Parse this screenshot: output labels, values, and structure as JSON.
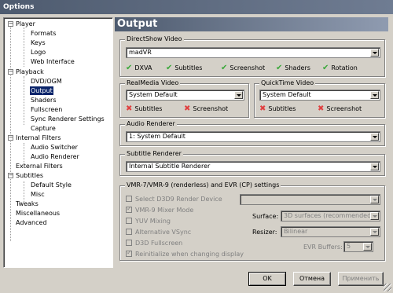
{
  "window": {
    "title": "Options"
  },
  "tree": {
    "player": "Player",
    "formats": "Formats",
    "keys": "Keys",
    "logo": "Logo",
    "web_interface": "Web Interface",
    "playback": "Playback",
    "dvd_ogm": "DVD/OGM",
    "output": "Output",
    "shaders": "Shaders",
    "fullscreen": "Fullscreen",
    "sync_renderer": "Sync Renderer Settings",
    "capture": "Capture",
    "internal_filters": "Internal Filters",
    "audio_switcher": "Audio Switcher",
    "audio_renderer": "Audio Renderer",
    "external_filters": "External Filters",
    "subtitles": "Subtitles",
    "default_style": "Default Style",
    "misc": "Misc",
    "tweaks": "Tweaks",
    "miscellaneous": "Miscellaneous",
    "advanced": "Advanced"
  },
  "page": {
    "title": "Output"
  },
  "directshow": {
    "label": "DirectShow Video",
    "value": "madVR",
    "caps": [
      "DXVA",
      "Subtitles",
      "Screenshot",
      "Shaders",
      "Rotation"
    ]
  },
  "realmedia": {
    "label": "RealMedia Video",
    "value": "System Default",
    "subtitles": "Subtitles",
    "screenshot": "Screenshot"
  },
  "quicktime": {
    "label": "QuickTime Video",
    "value": "System Default",
    "subtitles": "Subtitles",
    "screenshot": "Screenshot"
  },
  "audio": {
    "label": "Audio Renderer",
    "value": "1: System Default"
  },
  "subtitle_renderer": {
    "label": "Subtitle Renderer",
    "value": "Internal Subtitle Renderer"
  },
  "vmr": {
    "label": "VMR-7/VMR-9 (renderless) and EVR (CP) settings",
    "select_d3d9": "Select D3D9 Render Device",
    "mixer_mode": "VMR-9 Mixer Mode",
    "yuv_mixing": "YUV Mixing",
    "alt_vsync": "Alternative VSync",
    "d3d_fullscreen": "D3D Fullscreen",
    "reinitialize": "Reinitialize when changing display",
    "surface_label": "Surface:",
    "surface_value": "3D surfaces (recommended)",
    "resizer_label": "Resizer:",
    "resizer_value": "Bilinear",
    "evr_label": "EVR Buffers:",
    "evr_value": "5"
  },
  "buttons": {
    "ok": "OK",
    "cancel": "Отмена",
    "apply": "Применить"
  }
}
